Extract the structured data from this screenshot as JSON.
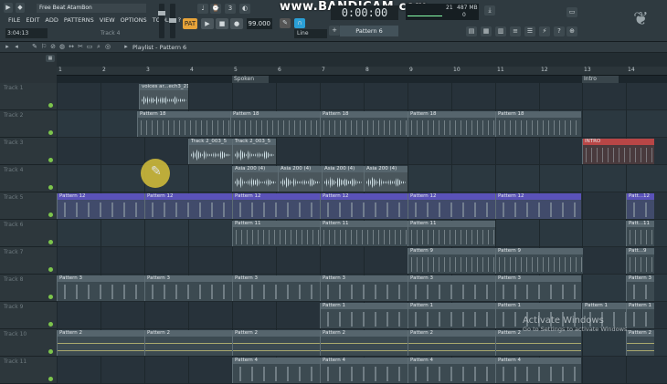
{
  "window_title": "Free Beat AtamBon",
  "menu": [
    "FILE",
    "EDIT",
    "ADD",
    "PATTERNS",
    "VIEW",
    "OPTIONS",
    "TOOLS",
    "?"
  ],
  "time_small": "3:04:13",
  "track_hint": "Track 4",
  "transport": {
    "pat_label": "PAT",
    "play": "▶",
    "stop": "■",
    "record": "●",
    "tempo": "99.000"
  },
  "watermark": "www.BANDICAM.com",
  "big_time": "0:00:00",
  "snap": "Line",
  "pattern_selector": "Pattern 6",
  "cpu": {
    "value1": "21",
    "value2": "487 MB",
    "value3": "0"
  },
  "playlist_title": "Playlist - Pattern 6",
  "bars": [
    "1",
    "2",
    "3",
    "4",
    "5",
    "6",
    "7",
    "8",
    "9",
    "10",
    "11",
    "12",
    "13",
    "14"
  ],
  "markers": [
    {
      "label": "Spoken"
    },
    {
      "label": "Intro"
    }
  ],
  "tracks": [
    {
      "name": "Track 1",
      "clips": [
        {
          "label": "voices ar...ech3_21"
        }
      ]
    },
    {
      "name": "Track 2",
      "clips": [
        {
          "label": "Pattern 18"
        },
        {
          "label": "Pattern 18"
        },
        {
          "label": "Pattern 18"
        },
        {
          "label": "Pattern 18"
        },
        {
          "label": "Pattern 18"
        }
      ]
    },
    {
      "name": "Track 3",
      "clips": [
        {
          "label": "Track 2_003_5"
        },
        {
          "label": "Track 2_003_5"
        },
        {
          "label": "INTRO"
        }
      ]
    },
    {
      "name": "Track 4",
      "clips": [
        {
          "label": "Asia 200 (4)"
        },
        {
          "label": "Asia 200 (4)"
        },
        {
          "label": "Asia 200 (4)"
        },
        {
          "label": "Asia 200 (4)"
        }
      ]
    },
    {
      "name": "Track 5",
      "clips": [
        {
          "label": "Pattern 12"
        },
        {
          "label": "Pattern 12"
        },
        {
          "label": "Pattern 12"
        },
        {
          "label": "Pattern 12"
        },
        {
          "label": "Pattern 12"
        },
        {
          "label": "Pattern 12"
        },
        {
          "label": "Patt...12"
        }
      ]
    },
    {
      "name": "Track 6",
      "clips": [
        {
          "label": "Pattern 11"
        },
        {
          "label": "Pattern 11"
        },
        {
          "label": "Pattern 11"
        },
        {
          "label": "Patt...11"
        }
      ]
    },
    {
      "name": "Track 7",
      "clips": [
        {
          "label": "Pattern 9"
        },
        {
          "label": "Pattern 9"
        },
        {
          "label": "Patt...9"
        }
      ]
    },
    {
      "name": "Track 8",
      "clips": [
        {
          "label": "Pattern 3"
        },
        {
          "label": "Pattern 3"
        },
        {
          "label": "Pattern 3"
        },
        {
          "label": "Pattern 3"
        },
        {
          "label": "Pattern 3"
        },
        {
          "label": "Pattern 3"
        },
        {
          "label": "Pattern 3"
        }
      ]
    },
    {
      "name": "Track 9",
      "clips": [
        {
          "label": "Pattern 1"
        },
        {
          "label": "Pattern 1"
        },
        {
          "label": "Pattern 1"
        },
        {
          "label": "Pattern 1"
        },
        {
          "label": "Pattern 1"
        }
      ]
    },
    {
      "name": "Track 10",
      "clips": [
        {
          "label": "Pattern 2"
        },
        {
          "label": "Pattern 2"
        },
        {
          "label": "Pattern 2"
        },
        {
          "label": "Pattern 2"
        },
        {
          "label": "Pattern 2"
        },
        {
          "label": "Pattern 2"
        },
        {
          "label": "Pattern 2"
        }
      ]
    },
    {
      "name": "Track 11",
      "clips": [
        {
          "label": "Pattern 4"
        },
        {
          "label": "Pattern 4"
        },
        {
          "label": "Pattern 4"
        },
        {
          "label": "Pattern 4"
        }
      ]
    }
  ],
  "activate": {
    "title": "Activate Windows",
    "subtitle": "Go to Settings to activate Windows."
  },
  "colors": {
    "accent": "#e7a339",
    "pattern_purple": "#5a52b8",
    "intro_red": "#b84646",
    "led_green": "#7cc44c"
  }
}
